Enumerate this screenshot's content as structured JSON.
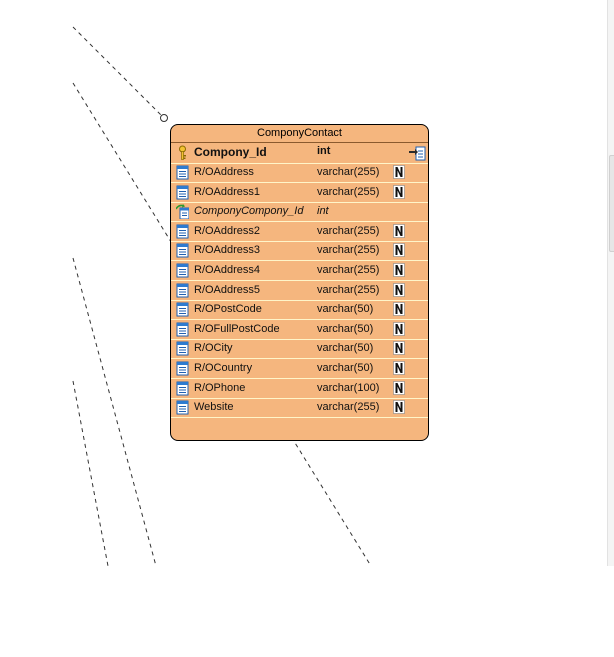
{
  "entity": {
    "title": "ComponyContact",
    "primary_key": {
      "name": "Compony_Id",
      "type": "int"
    },
    "columns": [
      {
        "name": "R/OAddress",
        "type": "varchar(255)",
        "nullable": true,
        "kind": "column"
      },
      {
        "name": "R/OAddress1",
        "type": "varchar(255)",
        "nullable": true,
        "kind": "column"
      },
      {
        "name": "ComponyCompony_Id",
        "type": "int",
        "nullable": false,
        "kind": "foreign-key"
      },
      {
        "name": "R/OAddress2",
        "type": "varchar(255)",
        "nullable": true,
        "kind": "column"
      },
      {
        "name": "R/OAddress3",
        "type": "varchar(255)",
        "nullable": true,
        "kind": "column"
      },
      {
        "name": "R/OAddress4",
        "type": "varchar(255)",
        "nullable": true,
        "kind": "column"
      },
      {
        "name": "R/OAddress5",
        "type": "varchar(255)",
        "nullable": true,
        "kind": "column"
      },
      {
        "name": "R/OPostCode",
        "type": "varchar(50)",
        "nullable": true,
        "kind": "column"
      },
      {
        "name": "R/OFullPostCode",
        "type": "varchar(50)",
        "nullable": true,
        "kind": "column"
      },
      {
        "name": "R/OCity",
        "type": "varchar(50)",
        "nullable": true,
        "kind": "column"
      },
      {
        "name": "R/OCountry",
        "type": "varchar(50)",
        "nullable": true,
        "kind": "column"
      },
      {
        "name": "R/OPhone",
        "type": "varchar(100)",
        "nullable": true,
        "kind": "column"
      },
      {
        "name": "Website",
        "type": "varchar(255)",
        "nullable": true,
        "kind": "column"
      }
    ]
  },
  "icons": {
    "primary_key": "key-icon",
    "column": "column-icon",
    "foreign_key": "foreign-key-icon",
    "nullable": "nullable-icon",
    "action": "entity-action-icon"
  },
  "colors": {
    "entity_fill": "#f5b67e",
    "row_separator": "#fff5c8",
    "border": "#000000"
  }
}
